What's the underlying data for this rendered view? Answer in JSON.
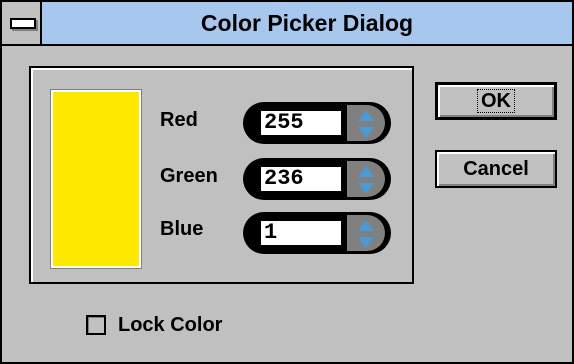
{
  "dialog": {
    "title": "Color Picker Dialog"
  },
  "swatch": {
    "color": "#ffe800"
  },
  "channels": [
    {
      "label": "Red",
      "value": "255"
    },
    {
      "label": "Green",
      "value": "236"
    },
    {
      "label": "Blue",
      "value": "1"
    }
  ],
  "buttons": {
    "ok": "OK",
    "cancel": "Cancel"
  },
  "lock": {
    "label": "Lock Color",
    "checked": false
  },
  "icons": {
    "system_menu": "system-menu-icon",
    "spin_up": "arrow-up-icon",
    "spin_down": "arrow-down-icon"
  },
  "colors": {
    "titlebar": "#a8c7ef",
    "face": "#c0c0c0",
    "arrow": "#4a9ad6"
  }
}
